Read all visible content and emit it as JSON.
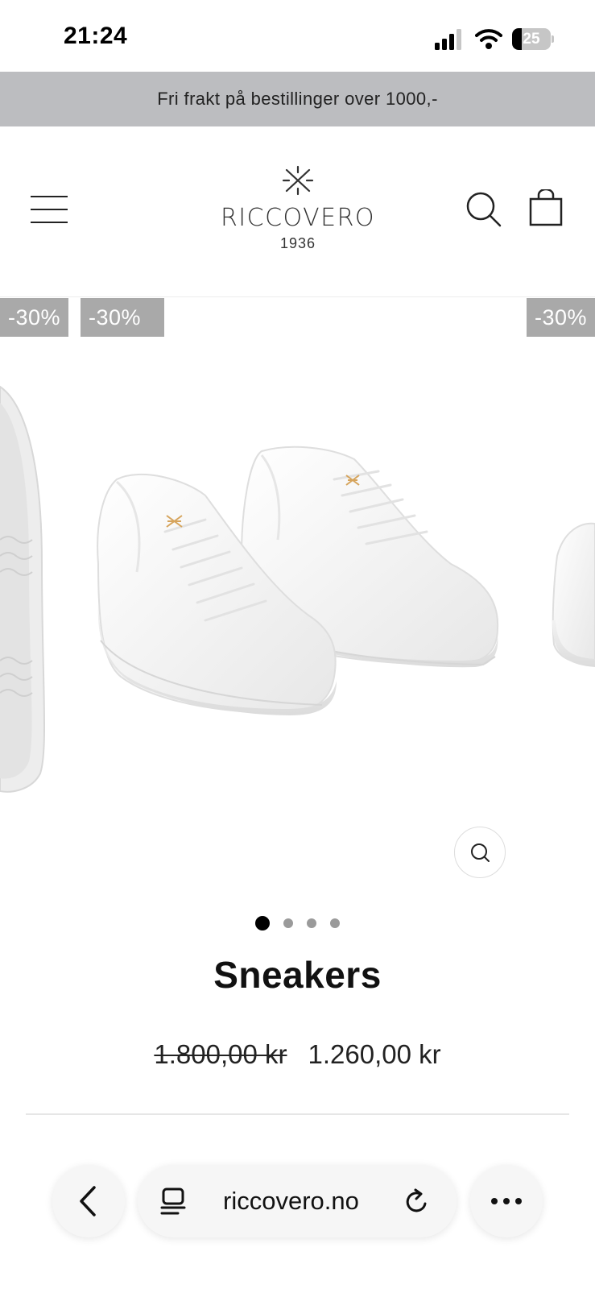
{
  "status_bar": {
    "time": "21:24",
    "battery_level": "25",
    "battery_fraction": 0.25,
    "icons": [
      "signal-icon",
      "wifi-icon",
      "battery-icon"
    ]
  },
  "announcement": {
    "text": "Fri frakt på bestillinger over 1000,-"
  },
  "header": {
    "logo_name": "RICCOVERO",
    "logo_year": "1936",
    "icons": [
      "menu-icon",
      "search-icon",
      "cart-icon"
    ]
  },
  "gallery": {
    "badges": [
      "-30%",
      "-30%",
      "-30%"
    ],
    "slide_count": 4,
    "active_slide": 1,
    "zoom_icon": "zoom-icon"
  },
  "product": {
    "title": "Sneakers",
    "price_old": "1.800,00 kr",
    "price_new": "1.260,00 kr"
  },
  "browser": {
    "url": "riccovero.no",
    "icons": [
      "back-icon",
      "tabs-icon",
      "reload-icon",
      "more-icon"
    ]
  },
  "colors": {
    "announcement_bg": "#bcbdc0",
    "badge_bg": "#a9a9a9",
    "logo_accent": "#d6a45c"
  }
}
